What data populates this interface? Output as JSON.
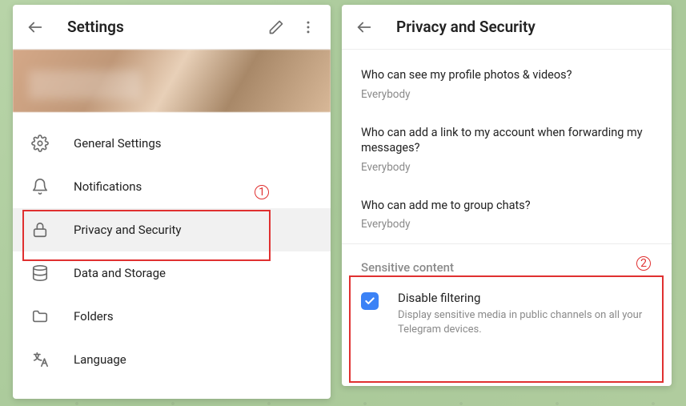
{
  "annotations": {
    "num1": "1",
    "num2": "2"
  },
  "left": {
    "title": "Settings",
    "items": [
      {
        "label": "General Settings"
      },
      {
        "label": "Notifications"
      },
      {
        "label": "Privacy and Security"
      },
      {
        "label": "Data and Storage"
      },
      {
        "label": "Folders"
      },
      {
        "label": "Language"
      }
    ]
  },
  "right": {
    "title": "Privacy and Security",
    "privacy": [
      {
        "q": "Who can see my profile photos & videos?",
        "v": "Everybody"
      },
      {
        "q": "Who can add a link to my account when forwarding my messages?",
        "v": "Everybody"
      },
      {
        "q": "Who can add me to group chats?",
        "v": "Everybody"
      }
    ],
    "sensitive": {
      "section_title": "Sensitive content",
      "check_label": "Disable filtering",
      "check_desc": "Display sensitive media in public channels on all your Telegram devices.",
      "checked": true
    }
  }
}
